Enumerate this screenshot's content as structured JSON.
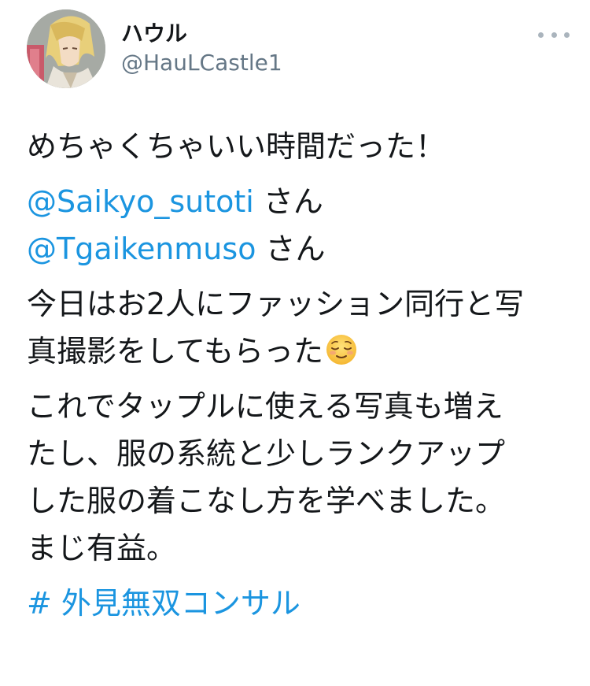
{
  "user": {
    "display_name": "ハウル",
    "handle": "@HauLCastle1"
  },
  "tweet": {
    "line1": "めちゃくちゃいい時間だった！",
    "mention1": "@Saikyo_sutoti",
    "mention1_suffix": " さん",
    "mention2": "@Tgaikenmuso",
    "mention2_suffix": " さん",
    "p3_line1": "今日はお2人にファッション同行と写",
    "p3_line2": "真撮影をしてもらった",
    "p4_line1": "これでタップルに使える写真も増え",
    "p4_line2": "たし、服の系統と少しランクアップ",
    "p4_line3": "した服の着こなし方を学べました。",
    "p4_line4": "まじ有益。",
    "hashtag": "# 外見無双コンサル"
  },
  "icons": {
    "more": "more-dots-icon",
    "emoji": "relieved-face-emoji"
  },
  "colors": {
    "link": "#1b95e0",
    "text": "#14171a",
    "muted": "#657786"
  }
}
